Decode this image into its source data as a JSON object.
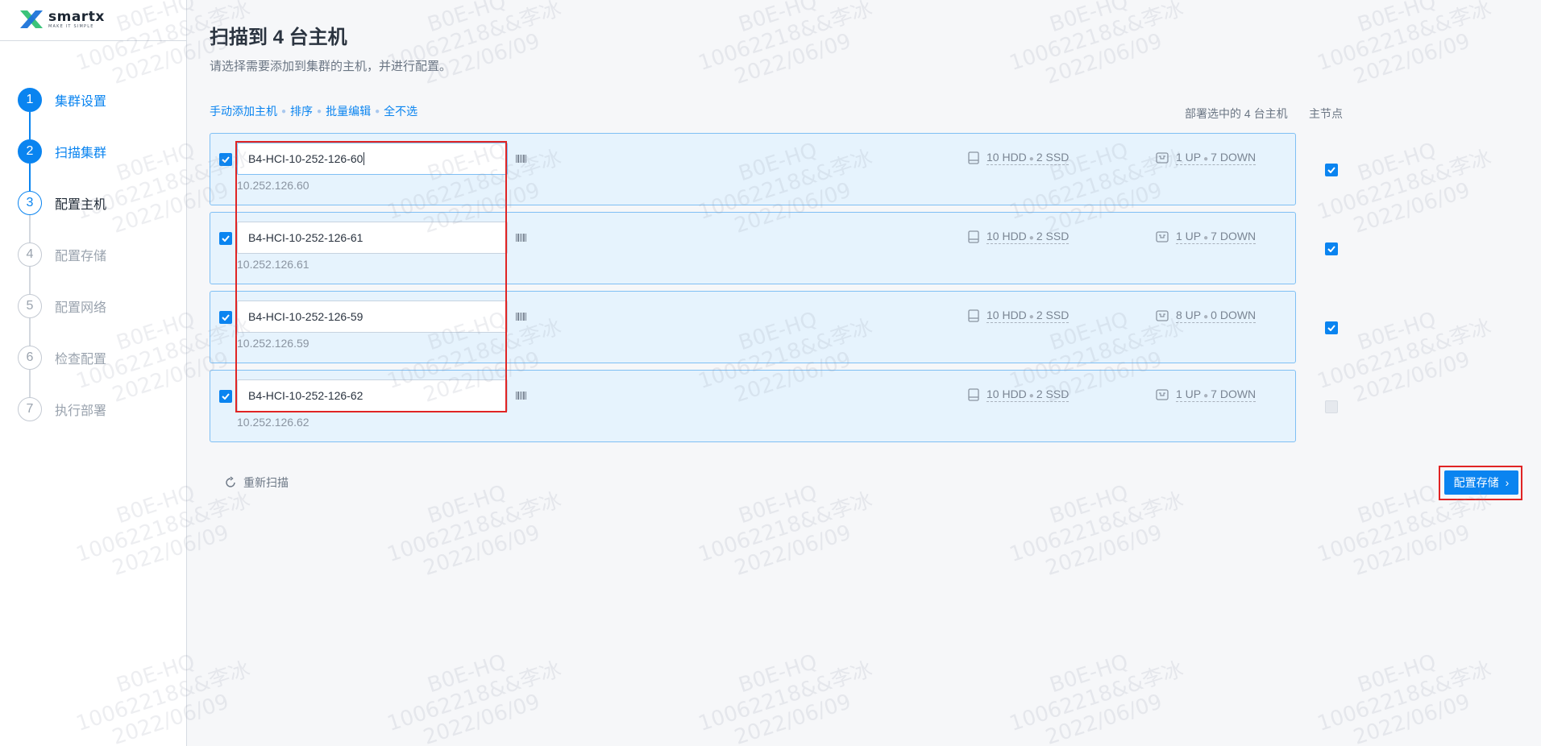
{
  "brand": {
    "name": "smartx",
    "tagline": "MAKE IT SIMPLE",
    "colors": {
      "primary": "#0a84f0",
      "logo_green": "#3cc37a",
      "logo_blue": "#1c74d9",
      "highlight_red": "#e02424"
    }
  },
  "sidebar": {
    "steps": [
      {
        "num": "1",
        "label": "集群设置",
        "state": "done"
      },
      {
        "num": "2",
        "label": "扫描集群",
        "state": "done"
      },
      {
        "num": "3",
        "label": "配置主机",
        "state": "active"
      },
      {
        "num": "4",
        "label": "配置存储",
        "state": "todo"
      },
      {
        "num": "5",
        "label": "配置网络",
        "state": "todo"
      },
      {
        "num": "6",
        "label": "检查配置",
        "state": "todo"
      },
      {
        "num": "7",
        "label": "执行部署",
        "state": "todo"
      }
    ]
  },
  "main": {
    "title": "扫描到 4 台主机",
    "subtitle": "请选择需要添加到集群的主机，并进行配置。",
    "actions": {
      "add_manual": "手动添加主机",
      "sort": "排序",
      "batch_edit": "批量编辑",
      "deselect_all": "全不选"
    },
    "deploy_count": "部署选中的 4 台主机",
    "master_header": "主节点",
    "hosts": [
      {
        "name": "B4-HCI-10-252-126-60",
        "ip": "10.252.126.60",
        "disks": "10 HDD",
        "ssd": "2 SSD",
        "nic_up": "1 UP",
        "nic_down": "7 DOWN",
        "master": true,
        "selected": true
      },
      {
        "name": "B4-HCI-10-252-126-61",
        "ip": "10.252.126.61",
        "disks": "10 HDD",
        "ssd": "2 SSD",
        "nic_up": "1 UP",
        "nic_down": "7 DOWN",
        "master": true,
        "selected": true
      },
      {
        "name": "B4-HCI-10-252-126-59",
        "ip": "10.252.126.59",
        "disks": "10 HDD",
        "ssd": "2 SSD",
        "nic_up": "8 UP",
        "nic_down": "0 DOWN",
        "master": true,
        "selected": true
      },
      {
        "name": "B4-HCI-10-252-126-62",
        "ip": "10.252.126.62",
        "disks": "10 HDD",
        "ssd": "2 SSD",
        "nic_up": "1 UP",
        "nic_down": "7 DOWN",
        "master": false,
        "selected": true
      }
    ],
    "rescan_label": "重新扫描",
    "next_label": "配置存储"
  },
  "watermark": {
    "line1": "B0E-HQ",
    "line2": "10062218&&李冰",
    "line3": "2022/06/09"
  }
}
